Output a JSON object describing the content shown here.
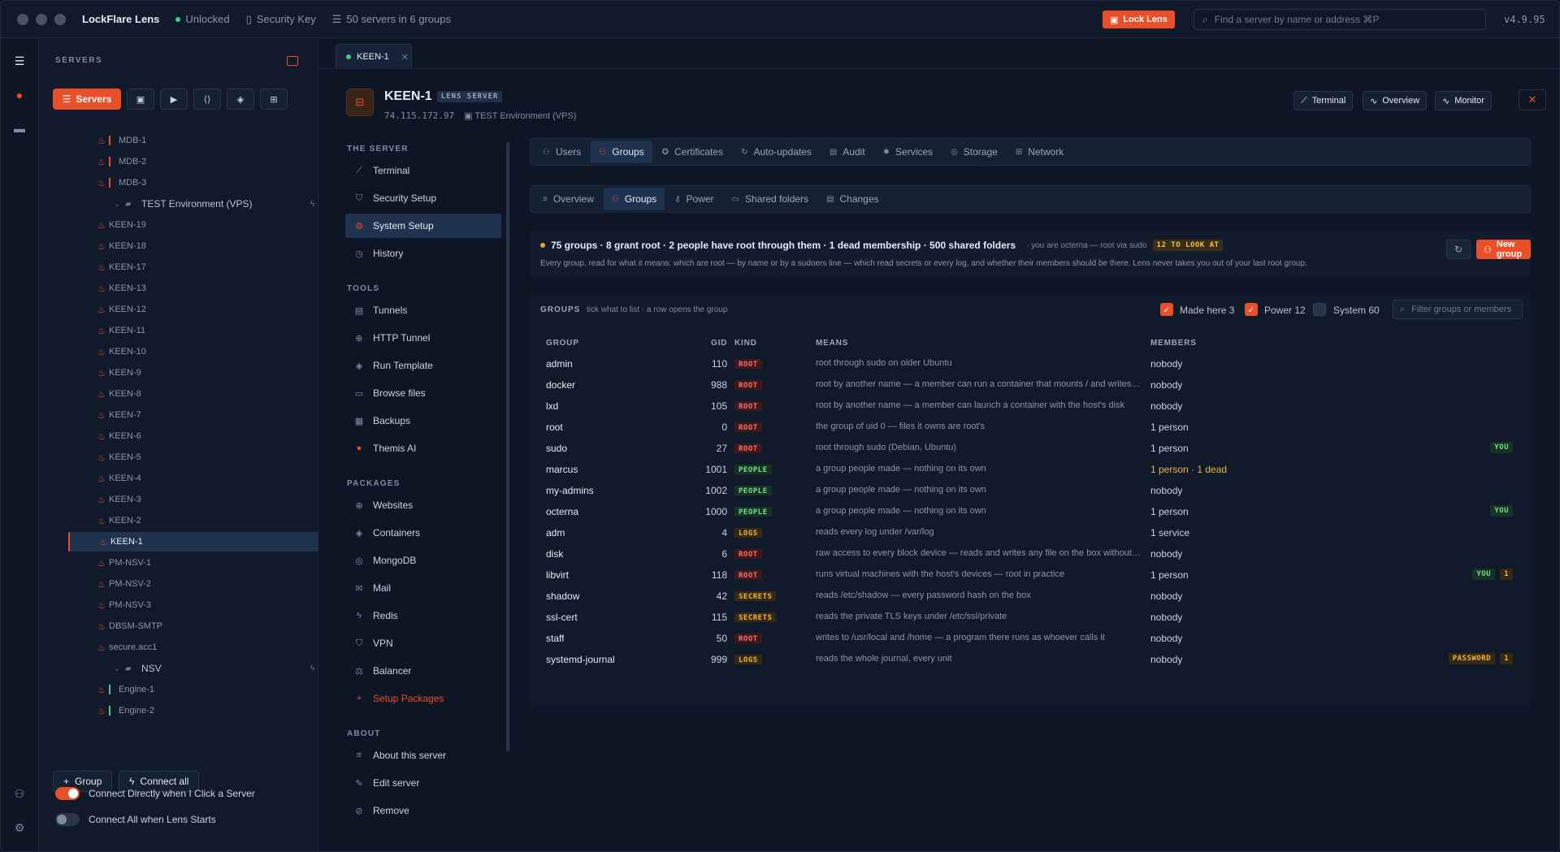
{
  "titlebar": {
    "app_name": "LockFlare Lens",
    "status": "Unlocked",
    "security_key": "Security Key",
    "servers_summary": "50 servers in 6 groups",
    "lock_button": "Lock Lens",
    "search_placeholder": "Find a server by name or address  ⌘P",
    "version": "v4.9.95"
  },
  "sidebar": {
    "heading": "SERVERS",
    "tools_active": "Servers",
    "tree": [
      {
        "type": "server",
        "name": "MDB-1",
        "bar": "#e8502a",
        "dot": "#8a96aa"
      },
      {
        "type": "server",
        "name": "MDB-2",
        "bar": "#e8502a",
        "dot": "#8a96aa"
      },
      {
        "type": "server",
        "name": "MDB-3",
        "bar": "#e8502a",
        "dot": "#8a96aa"
      },
      {
        "type": "group",
        "name": "TEST Environment (VPS)"
      },
      {
        "type": "server",
        "name": "KEEN-19"
      },
      {
        "type": "server",
        "name": "KEEN-18"
      },
      {
        "type": "server",
        "name": "KEEN-17"
      },
      {
        "type": "server",
        "name": "KEEN-13"
      },
      {
        "type": "server",
        "name": "KEEN-12"
      },
      {
        "type": "server",
        "name": "KEEN-11"
      },
      {
        "type": "server",
        "name": "KEEN-10"
      },
      {
        "type": "server",
        "name": "KEEN-9"
      },
      {
        "type": "server",
        "name": "KEEN-8"
      },
      {
        "type": "server",
        "name": "KEEN-7"
      },
      {
        "type": "server",
        "name": "KEEN-6"
      },
      {
        "type": "server",
        "name": "KEEN-5"
      },
      {
        "type": "server",
        "name": "KEEN-4"
      },
      {
        "type": "server",
        "name": "KEEN-3"
      },
      {
        "type": "server",
        "name": "KEEN-2"
      },
      {
        "type": "server",
        "name": "KEEN-1",
        "selected": true,
        "dot": "#3ecf8e"
      },
      {
        "type": "server",
        "name": "PM-NSV-1"
      },
      {
        "type": "server",
        "name": "PM-NSV-2"
      },
      {
        "type": "server",
        "name": "PM-NSV-3"
      },
      {
        "type": "server",
        "name": "DBSM-SMTP"
      },
      {
        "type": "server",
        "name": "secure.acc1"
      },
      {
        "type": "group",
        "name": "NSV"
      },
      {
        "type": "server",
        "name": "Engine-1",
        "bar": "#3ecf8e"
      },
      {
        "type": "server",
        "name": "Engine-2",
        "bar": "#3ecf8e"
      }
    ],
    "add_group": "Group",
    "connect_all": "Connect all",
    "toggle_connect_directly": "Connect Directly when I Click a Server",
    "toggle_connect_all": "Connect All when Lens Starts"
  },
  "main": {
    "file_tab": "KEEN-1",
    "server": {
      "name": "KEEN-1",
      "badge": "LENS SERVER",
      "address": "74.115.172.97",
      "group": "TEST Environment (VPS)"
    },
    "header_buttons": {
      "terminal": "Terminal",
      "overview": "Overview",
      "monitor": "Monitor"
    },
    "menu": {
      "sections": [
        {
          "title": "THE SERVER",
          "items": [
            {
              "label": "Terminal",
              "icon": "⟋"
            },
            {
              "label": "Security Setup",
              "icon": "⛉"
            },
            {
              "label": "System Setup",
              "icon": "⚙",
              "selected": true
            },
            {
              "label": "History",
              "icon": "◷"
            }
          ]
        },
        {
          "title": "TOOLS",
          "items": [
            {
              "label": "Tunnels",
              "icon": "▤"
            },
            {
              "label": "HTTP Tunnel",
              "icon": "⊕"
            },
            {
              "label": "Run Template",
              "icon": "◈"
            },
            {
              "label": "Browse files",
              "icon": "▭"
            },
            {
              "label": "Backups",
              "icon": "▦"
            },
            {
              "label": "Themis AI",
              "icon": "●",
              "accent_icon": true
            }
          ]
        },
        {
          "title": "PACKAGES",
          "items": [
            {
              "label": "Websites",
              "icon": "⊕"
            },
            {
              "label": "Containers",
              "icon": "◈"
            },
            {
              "label": "MongoDB",
              "icon": "◎"
            },
            {
              "label": "Mail",
              "icon": "✉"
            },
            {
              "label": "Redis",
              "icon": "ϟ"
            },
            {
              "label": "VPN",
              "icon": "⛉"
            },
            {
              "label": "Balancer",
              "icon": "⚖"
            },
            {
              "label": "Setup Packages",
              "icon": "+",
              "accent": true
            }
          ]
        },
        {
          "title": "ABOUT",
          "items": [
            {
              "label": "About this server",
              "icon": "≡"
            },
            {
              "label": "Edit server",
              "icon": "✎"
            },
            {
              "label": "Remove",
              "icon": "⊘"
            }
          ]
        }
      ]
    },
    "tabs_primary": [
      {
        "label": "Users",
        "icon": "⚇"
      },
      {
        "label": "Groups",
        "icon": "⚇",
        "selected": true
      },
      {
        "label": "Certificates",
        "icon": "✪"
      },
      {
        "label": "Auto-updates",
        "icon": "↻"
      },
      {
        "label": "Audit",
        "icon": "▤"
      },
      {
        "label": "Services",
        "icon": "✹"
      },
      {
        "label": "Storage",
        "icon": "◎"
      },
      {
        "label": "Network",
        "icon": "⊞"
      }
    ],
    "tabs_secondary": [
      {
        "label": "Overview",
        "icon": "≡"
      },
      {
        "label": "Groups",
        "icon": "⚇",
        "selected": true
      },
      {
        "label": "Power",
        "icon": "⚷"
      },
      {
        "label": "Shared folders",
        "icon": "▭"
      },
      {
        "label": "Changes",
        "icon": "▤"
      }
    ],
    "summary": {
      "headline": "75 groups · 8 grant root · 2 people have root through them · 1 dead membership · 500 shared folders",
      "context": "· you are octerna — root via sudo",
      "badge": "12 TO LOOK AT",
      "description": "Every group, read for what it means: which are root — by name or by a sudoers line — which read secrets or every log, and whether their members should be there. Lens never takes you out of your last root group.",
      "new_group": "New group"
    },
    "groups_panel": {
      "title": "GROUPS",
      "hint": "tick what to list · a row opens the group",
      "filters": [
        {
          "label": "Made here 3",
          "checked": true
        },
        {
          "label": "Power 12",
          "checked": true
        },
        {
          "label": "System 60",
          "checked": false
        }
      ],
      "filter_placeholder": "Filter groups or members",
      "columns": {
        "group": "GROUP",
        "gid": "GID",
        "kind": "KIND",
        "means": "MEANS",
        "members": "MEMBERS"
      },
      "rows": [
        {
          "group": "admin",
          "gid": "110",
          "kind": "ROOT",
          "means": "root through sudo on older Ubuntu",
          "members": "nobody"
        },
        {
          "group": "docker",
          "gid": "988",
          "kind": "ROOT",
          "means": "root by another name — a member can run a container that mounts / and writes anything",
          "members": "nobody"
        },
        {
          "group": "lxd",
          "gid": "105",
          "kind": "ROOT",
          "means": "root by another name — a member can launch a container with the host's disk",
          "members": "nobody"
        },
        {
          "group": "root",
          "gid": "0",
          "kind": "ROOT",
          "means": "the group of uid 0 — files it owns are root's",
          "members": "1 person"
        },
        {
          "group": "sudo",
          "gid": "27",
          "kind": "ROOT",
          "means": "root through sudo (Debian, Ubuntu)",
          "members": "1 person",
          "you": "YOU"
        },
        {
          "group": "marcus",
          "gid": "1001",
          "kind": "PEOPLE",
          "means": "a group people made — nothing on its own",
          "members": "1 person · 1 dead",
          "warn": true
        },
        {
          "group": "my-admins",
          "gid": "1002",
          "kind": "PEOPLE",
          "means": "a group people made — nothing on its own",
          "members": "nobody"
        },
        {
          "group": "octerna",
          "gid": "1000",
          "kind": "PEOPLE",
          "means": "a group people made — nothing on its own",
          "members": "1 person",
          "you": "YOU"
        },
        {
          "group": "adm",
          "gid": "4",
          "kind": "LOGS",
          "means": "reads every log under /var/log",
          "members": "1 service"
        },
        {
          "group": "disk",
          "gid": "6",
          "kind": "ROOT",
          "means": "raw access to every block device — reads and writes any file on the box without permission",
          "members": "nobody"
        },
        {
          "group": "libvirt",
          "gid": "118",
          "kind": "ROOT",
          "means": "runs virtual machines with the host's devices — root in practice",
          "members": "1 person",
          "you": "YOU",
          "count": "1"
        },
        {
          "group": "shadow",
          "gid": "42",
          "kind": "SECRETS",
          "means": "reads /etc/shadow — every password hash on the box",
          "members": "nobody"
        },
        {
          "group": "ssl-cert",
          "gid": "115",
          "kind": "SECRETS",
          "means": "reads the private TLS keys under /etc/ssl/private",
          "members": "nobody"
        },
        {
          "group": "staff",
          "gid": "50",
          "kind": "ROOT",
          "means": "writes to /usr/local and /home — a program there runs as whoever calls it",
          "members": "nobody"
        },
        {
          "group": "systemd-journal",
          "gid": "999",
          "kind": "LOGS",
          "means": "reads the whole journal, every unit",
          "members": "nobody",
          "pw": "PASSWORD",
          "count": "1"
        }
      ]
    }
  }
}
